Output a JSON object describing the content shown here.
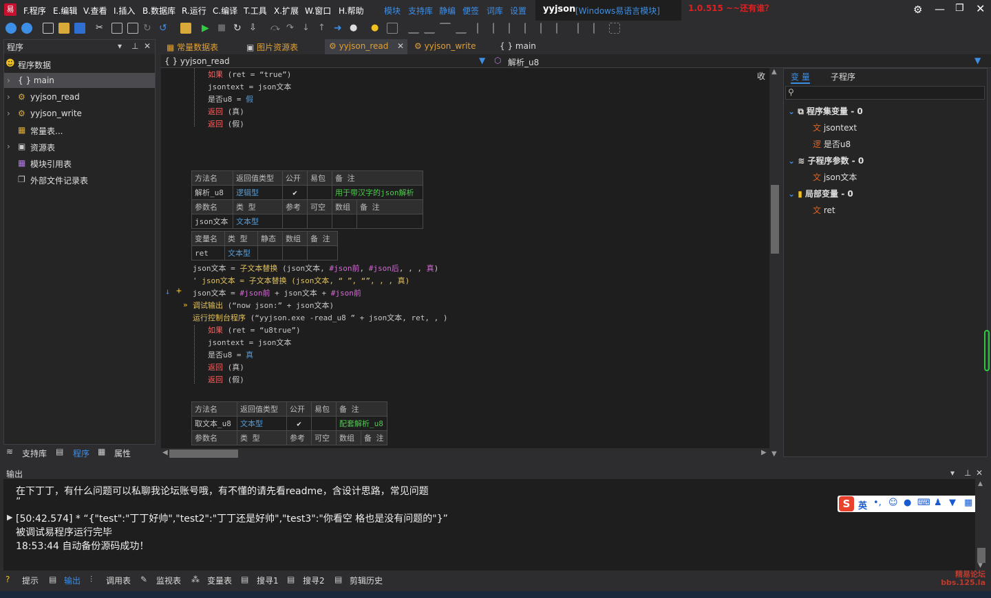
{
  "menubar": {
    "items": [
      "F.程序",
      "E.编辑",
      "V.查看",
      "I.插入",
      "B.数据库",
      "R.运行",
      "C.编译",
      "T.工具",
      "X.扩展",
      "W.窗口",
      "H.帮助"
    ],
    "quick_links": [
      "模块",
      "支持库",
      "静编",
      "便签",
      "词库",
      "设置"
    ],
    "app_name": "yyjson",
    "app_subtitle": "[Windows易语言模块]",
    "version_note": "1.0.515 ~~还有谁？"
  },
  "left_panel": {
    "title": "程序",
    "items": [
      {
        "label": "程序数据"
      },
      {
        "label": "{ } main"
      },
      {
        "label": "yyjson_read"
      },
      {
        "label": "yyjson_write"
      },
      {
        "label": "常量表..."
      },
      {
        "label": "资源表"
      },
      {
        "label": "模块引用表"
      },
      {
        "label": "外部文件记录表"
      }
    ],
    "tabs": [
      "支持库",
      "程序",
      "属性"
    ]
  },
  "doc_tabs": [
    "常量数据表",
    "图片资源表",
    "yyjson_read",
    "yyjson_write",
    "{ } main"
  ],
  "navbar": {
    "left": "{ } yyjson_read",
    "right": "解析_u8"
  },
  "editor": {
    "collapse_label": "收",
    "block1": [
      "如果",
      "(ret = “true”)",
      "jsontext = json文本",
      "是否u8 = ",
      "假",
      "返回",
      "(真)",
      "返回",
      "(假)"
    ],
    "method_table1": {
      "headers": [
        "方法名",
        "返回值类型",
        "公开",
        "易包",
        "备 注"
      ],
      "row": [
        "解析_u8",
        "逻辑型",
        "✔",
        "",
        "用于带汉字的json解析"
      ],
      "param_headers": [
        "参数名",
        "类 型",
        "参考",
        "可空",
        "数组",
        "备 注"
      ],
      "param_row": [
        "json文本",
        "文本型",
        "",
        "",
        "",
        ""
      ]
    },
    "var_table": {
      "headers": [
        "变量名",
        "类 型",
        "静态",
        "数组",
        "备 注"
      ],
      "row": [
        "ret",
        "文本型",
        "",
        "",
        ""
      ]
    },
    "code_lines": [
      {
        "a": "json文本 = ",
        "b": "子文本替换",
        "c": " (json文本, ",
        "d": "#json前",
        "e": ", ",
        "f": "#json后",
        "g": ", , , ",
        "h": "真",
        "i": ")"
      },
      {
        "a": "' json文本 = 子文本替换 (json文本, “ ”, “”, , , 真)"
      },
      {
        "a": "json文本 = ",
        "b": "#json前",
        "c": " + json文本 + ",
        "d": "#json前"
      },
      {
        "a": "调试输出",
        "b": " (“now json:” + json文本)"
      },
      {
        "a": "运行控制台程序",
        "b": " (“yyjson.exe -read_u8 ” + json文本, ret, , )"
      }
    ],
    "block2": [
      "如果",
      "(ret = “u8true”)",
      "jsontext = json文本",
      "是否u8 = ",
      "真",
      "返回",
      "(真)",
      "返回",
      "(假)"
    ],
    "method_table2": {
      "headers": [
        "方法名",
        "返回值类型",
        "公开",
        "易包",
        "备 注"
      ],
      "row": [
        "取文本_u8",
        "文本型",
        "✔",
        "",
        "配套解析_u8"
      ],
      "param_headers": [
        "参数名",
        "类 型",
        "参考",
        "可空",
        "数组",
        "备 注"
      ]
    }
  },
  "right_panel": {
    "tabs": [
      "变 量",
      "子程序"
    ],
    "groups": [
      {
        "label": "程序集变量 - 0",
        "items": [
          {
            "icon": "文",
            "name": "jsontext"
          },
          {
            "icon": "逻",
            "name": "是否u8"
          }
        ]
      },
      {
        "label": "子程序参数 - 0",
        "items": [
          {
            "icon": "文",
            "name": "json文本"
          }
        ]
      },
      {
        "label": "局部变量 - 0",
        "items": [
          {
            "icon": "文",
            "name": "ret"
          }
        ]
      }
    ]
  },
  "output": {
    "title": "输出",
    "lines": [
      "在下丁丁，有什么问题可以私聊我论坛账号哦，有不懂的请先看readme，含设计思路，常见问题",
      "”",
      "[50:42.574] *  “{\"test\":\"丁丁好帅\",\"test2\":\"丁丁还是好帅\",\"test3\":\"你看空 格也是没有问题的\"}”",
      "被调试易程序运行完毕",
      "18:53:44 自动备份源码成功！"
    ]
  },
  "bottom_tabs": [
    "提示",
    "输出",
    "调用表",
    "监视表",
    "变量表",
    "搜寻1",
    "搜寻2",
    "剪辑历史"
  ],
  "ime_label": "英",
  "watermark": "精易论坛 bbs.125.la",
  "colors": {
    "accent": "#3d8fe6",
    "keyword": "#f06464",
    "type": "#569cd6",
    "constant": "#d36bd3",
    "comment": "#4ec94e"
  }
}
